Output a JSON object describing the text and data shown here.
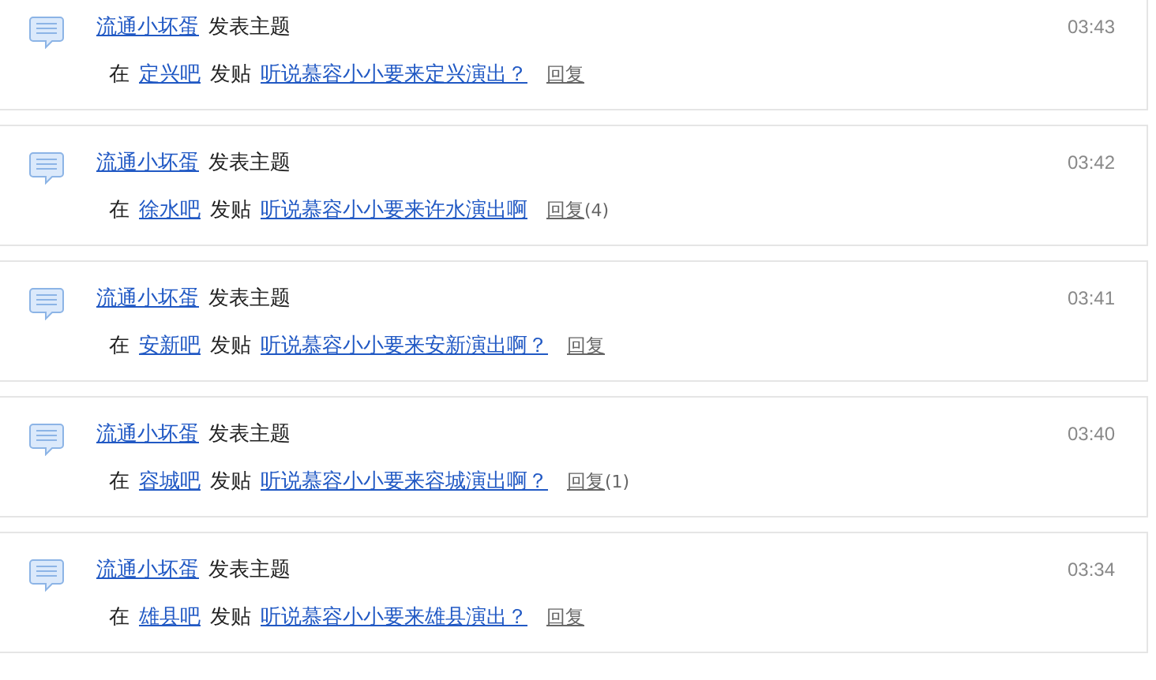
{
  "feed": [
    {
      "user": "流通小坏蛋",
      "action": "发表主题",
      "in_label": "在",
      "forum": "定兴吧",
      "post_label": "发贴",
      "title": "听说慕容小小要来定兴演出？",
      "reply": "回复",
      "time": "03:43"
    },
    {
      "user": "流通小坏蛋",
      "action": "发表主题",
      "in_label": "在",
      "forum": "徐水吧",
      "post_label": "发贴",
      "title": "听说慕容小小要来许水演出啊",
      "reply": "回复",
      "count": "(4)",
      "time": "03:42"
    },
    {
      "user": "流通小坏蛋",
      "action": "发表主题",
      "in_label": "在",
      "forum": "安新吧",
      "post_label": "发贴",
      "title": "听说慕容小小要来安新演出啊？",
      "reply": "回复",
      "time": "03:41"
    },
    {
      "user": "流通小坏蛋",
      "action": "发表主题",
      "in_label": "在",
      "forum": "容城吧",
      "post_label": "发贴",
      "title": "听说慕容小小要来容城演出啊？",
      "reply": "回复",
      "count": "(1)",
      "time": "03:40"
    },
    {
      "user": "流通小坏蛋",
      "action": "发表主题",
      "in_label": "在",
      "forum": "雄县吧",
      "post_label": "发贴",
      "title": "听说慕容小小要来雄县演出？",
      "reply": "回复",
      "time": "03:34"
    }
  ]
}
